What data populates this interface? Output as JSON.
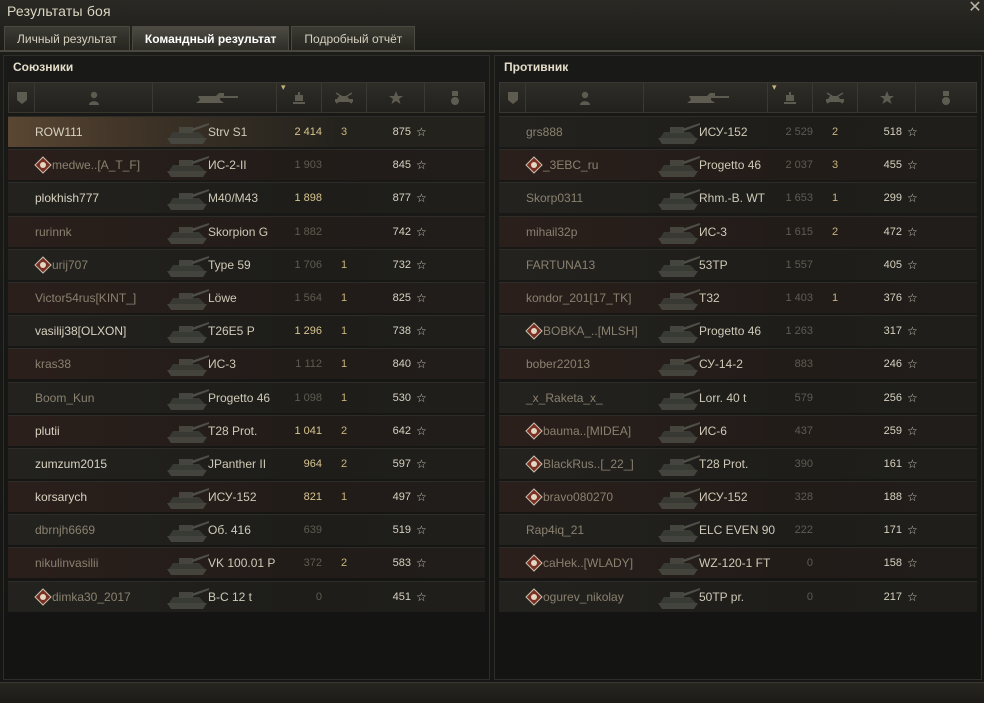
{
  "window": {
    "title": "Результаты боя",
    "close_icon": "close-icon"
  },
  "tabs": [
    {
      "label": "Личный результат",
      "active": false
    },
    {
      "label": "Командный результат",
      "active": true
    },
    {
      "label": "Подробный отчёт",
      "active": false
    }
  ],
  "allies": {
    "title": "Союзники",
    "players": [
      {
        "name": "ROW111",
        "vehicle": "Strv S1",
        "damage": "2 414",
        "kills": "3",
        "xp": "875",
        "highlight": true,
        "dim": false,
        "icon": ""
      },
      {
        "name": "medwe..[A_T_F]",
        "vehicle": "ИС-2-II",
        "damage": "1 903",
        "kills": "",
        "xp": "845",
        "dim": true,
        "icon": "clan-emblem-icon"
      },
      {
        "name": "plokhish777",
        "vehicle": "M40/M43",
        "damage": "1 898",
        "kills": "",
        "xp": "877",
        "dim": false,
        "icon": ""
      },
      {
        "name": "rurinnk",
        "vehicle": "Skorpion G",
        "damage": "1 882",
        "kills": "",
        "xp": "742",
        "dim": true,
        "icon": ""
      },
      {
        "name": "urij707",
        "vehicle": "Type 59",
        "damage": "1 706",
        "kills": "1",
        "xp": "732",
        "dim": true,
        "icon": "clan-emblem-icon"
      },
      {
        "name": "Victor54rus[KINT_]",
        "vehicle": "Löwe",
        "damage": "1 564",
        "kills": "1",
        "xp": "825",
        "dim": true,
        "icon": ""
      },
      {
        "name": "vasilij38[OLXON]",
        "vehicle": "T26E5 P",
        "damage": "1 296",
        "kills": "1",
        "xp": "738",
        "dim": false,
        "icon": ""
      },
      {
        "name": "kras38",
        "vehicle": "ИС-3",
        "damage": "1 112",
        "kills": "1",
        "xp": "840",
        "dim": true,
        "icon": ""
      },
      {
        "name": "Boom_Kun",
        "vehicle": "Progetto 46",
        "damage": "1 098",
        "kills": "1",
        "xp": "530",
        "dim": true,
        "icon": ""
      },
      {
        "name": "plutii",
        "vehicle": "T28 Prot.",
        "damage": "1 041",
        "kills": "2",
        "xp": "642",
        "dim": false,
        "icon": ""
      },
      {
        "name": "zumzum2015",
        "vehicle": "JPanther II",
        "damage": "964",
        "kills": "2",
        "xp": "597",
        "dim": false,
        "icon": ""
      },
      {
        "name": "korsarych",
        "vehicle": "ИСУ-152",
        "damage": "821",
        "kills": "1",
        "xp": "497",
        "dim": false,
        "icon": ""
      },
      {
        "name": "dbrnjh6669",
        "vehicle": "Об. 416",
        "damage": "639",
        "kills": "",
        "xp": "519",
        "dim": true,
        "icon": ""
      },
      {
        "name": "nikulinvasilii",
        "vehicle": "VK 100.01 P",
        "damage": "372",
        "kills": "2",
        "xp": "583",
        "dim": true,
        "icon": ""
      },
      {
        "name": "dimka30_2017",
        "vehicle": "В-С 12 t",
        "damage": "0",
        "kills": "",
        "xp": "451",
        "dim": true,
        "icon": "clan-emblem-icon"
      }
    ]
  },
  "enemies": {
    "title": "Противник",
    "players": [
      {
        "name": "grs888",
        "vehicle": "ИСУ-152",
        "damage": "2 529",
        "kills": "2",
        "xp": "518",
        "dim": true,
        "icon": ""
      },
      {
        "name": "_3EBC_ru",
        "vehicle": "Progetto 46",
        "damage": "2 037",
        "kills": "3",
        "xp": "455",
        "dim": true,
        "icon": "clan-emblem-icon"
      },
      {
        "name": "Skorp0311",
        "vehicle": "Rhm.-B. WT",
        "damage": "1 653",
        "kills": "1",
        "xp": "299",
        "dim": true,
        "icon": ""
      },
      {
        "name": "mihail32p",
        "vehicle": "ИС-3",
        "damage": "1 615",
        "kills": "2",
        "xp": "472",
        "dim": true,
        "icon": ""
      },
      {
        "name": "FARTUNA13",
        "vehicle": "53TP",
        "damage": "1 557",
        "kills": "",
        "xp": "405",
        "dim": true,
        "icon": ""
      },
      {
        "name": "kondor_201[17_TK]",
        "vehicle": "T32",
        "damage": "1 403",
        "kills": "1",
        "xp": "376",
        "dim": true,
        "icon": ""
      },
      {
        "name": "BOBKA_..[MLSH]",
        "vehicle": "Progetto 46",
        "damage": "1 263",
        "kills": "",
        "xp": "317",
        "dim": true,
        "icon": "clan-emblem-icon"
      },
      {
        "name": "bober22013",
        "vehicle": "СУ-14-2",
        "damage": "883",
        "kills": "",
        "xp": "246",
        "dim": true,
        "icon": ""
      },
      {
        "name": "_x_Raketa_x_",
        "vehicle": "Lorr. 40 t",
        "damage": "579",
        "kills": "",
        "xp": "256",
        "dim": true,
        "icon": ""
      },
      {
        "name": "bauma..[MIDEA]",
        "vehicle": "ИС-6",
        "damage": "437",
        "kills": "",
        "xp": "259",
        "dim": true,
        "icon": "clan-emblem-icon"
      },
      {
        "name": "BlackRus..[_22_]",
        "vehicle": "T28 Prot.",
        "damage": "390",
        "kills": "",
        "xp": "161",
        "dim": true,
        "icon": "clan-emblem-icon"
      },
      {
        "name": "bravo080270",
        "vehicle": "ИСУ-152",
        "damage": "328",
        "kills": "",
        "xp": "188",
        "dim": true,
        "icon": "clan-emblem-icon"
      },
      {
        "name": "Rap4iq_21",
        "vehicle": "ELC EVEN 90",
        "damage": "222",
        "kills": "",
        "xp": "171",
        "dim": true,
        "icon": ""
      },
      {
        "name": "caHek..[WLADY]",
        "vehicle": "WZ-120-1 FT",
        "damage": "0",
        "kills": "",
        "xp": "158",
        "dim": true,
        "icon": "clan-emblem-icon"
      },
      {
        "name": "ogurev_nikolay",
        "vehicle": "50TP pr.",
        "damage": "0",
        "kills": "",
        "xp": "217",
        "dim": true,
        "icon": "clan-emblem-icon"
      }
    ]
  },
  "columns": {
    "squad_icon": "squad-icon",
    "player_icon": "player-icon",
    "tank_icon": "tank-icon",
    "damage_icon": "damage-icon",
    "kills_icon": "kills-icon",
    "xp_icon": "star-icon",
    "medal_icon": "medal-icon"
  },
  "colors": {
    "accent": "#d8c48f",
    "highlight_row": "#5a4632",
    "text": "#d8d2c0",
    "dim_text": "#8a8170"
  },
  "xp_star": "☆"
}
